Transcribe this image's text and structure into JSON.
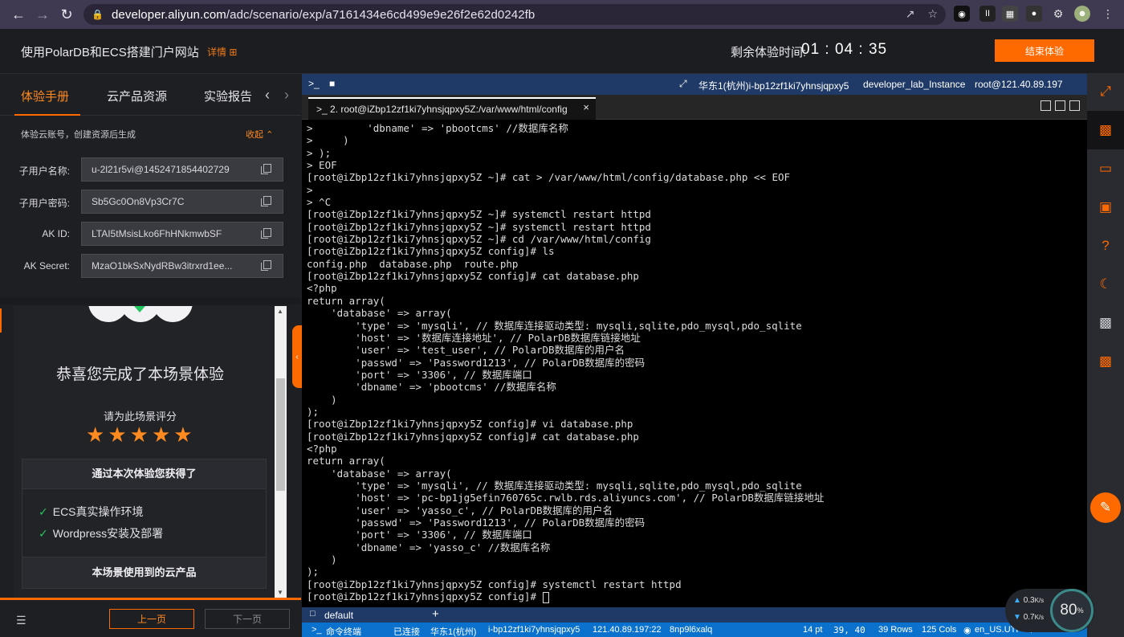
{
  "browser": {
    "url_prefix": "developer.aliyun.com",
    "url_path": "/adc/scenario/exp/a7161434e6cd499e9e26f2e62d0242fb"
  },
  "header": {
    "title": "使用PolarDB和ECS搭建门户网站",
    "detail_link": "详情",
    "timer_label": "剩余体验时间:",
    "timer_h": "01",
    "timer_m": "04",
    "timer_s": "35",
    "end_button": "结束体验"
  },
  "left_panel": {
    "tabs": [
      "体验手册",
      "云产品资源",
      "实验报告"
    ],
    "account_note": "体验云账号，创建资源后生成",
    "collapse_label": "收起",
    "fields": [
      {
        "label": "子用户名称:",
        "value": "u-2l21r5vi@1452471854402729"
      },
      {
        "label": "子用户密码:",
        "value": "Sb5Gc0On8Vp3Cr7C"
      },
      {
        "label": "AK ID:",
        "value": "LTAI5tMsisLko6FhHNkmwbSF"
      },
      {
        "label": "AK Secret:",
        "value": "MzaO1bkSxNydRBw3itrxrd1ee..."
      }
    ],
    "congrats": "恭喜您完成了本场景体验",
    "rate_prompt": "请为此场景评分",
    "rating_stars": 5,
    "gain_title": "通过本次体验您获得了",
    "gain_items": [
      "ECS真实操作环境",
      "Wordpress安装及部署"
    ],
    "products_title": "本场景使用到的云产品",
    "prev_button": "上一页",
    "next_button": "下一页"
  },
  "terminal": {
    "region_info": "华东1(杭州)i-bp12zf1ki7yhnsjqpxy5",
    "instance_name": "developer_lab_Instance",
    "login": "root@121.40.89.197",
    "tab_title": "2. root@iZbp12zf1ki7yhnsjqpxy5Z:/var/www/html/config",
    "lines": [
      ">         'dbname' => 'pbootcms' //数据库名称",
      ">     )",
      "> );",
      "> EOF",
      "[root@iZbp12zf1ki7yhnsjqpxy5Z ~]# cat > /var/www/html/config/database.php << EOF",
      ">",
      "> ^C",
      "[root@iZbp12zf1ki7yhnsjqpxy5Z ~]# systemctl restart httpd",
      "[root@iZbp12zf1ki7yhnsjqpxy5Z ~]# systemctl restart httpd",
      "[root@iZbp12zf1ki7yhnsjqpxy5Z ~]# cd /var/www/html/config",
      "[root@iZbp12zf1ki7yhnsjqpxy5Z config]# ls",
      "config.php  database.php  route.php",
      "[root@iZbp12zf1ki7yhnsjqpxy5Z config]# cat database.php",
      "<?php",
      "return array(",
      "    'database' => array(",
      "        'type' => 'mysqli', // 数据库连接驱动类型: mysqli,sqlite,pdo_mysql,pdo_sqlite",
      "        'host' => '数据库连接地址', // PolarDB数据库链接地址",
      "        'user' => 'test_user', // PolarDB数据库的用户名",
      "        'passwd' => 'Password1213', // PolarDB数据库的密码",
      "        'port' => '3306', // 数据库端口",
      "        'dbname' => 'pbootcms' //数据库名称",
      "    )",
      ");",
      "[root@iZbp12zf1ki7yhnsjqpxy5Z config]# vi database.php",
      "[root@iZbp12zf1ki7yhnsjqpxy5Z config]# cat database.php",
      "<?php",
      "return array(",
      "    'database' => array(",
      "        'type' => 'mysqli', // 数据库连接驱动类型: mysqli,sqlite,pdo_mysql,pdo_sqlite",
      "        'host' => 'pc-bp1jg5efin760765c.rwlb.rds.aliyuncs.com', // PolarDB数据库链接地址",
      "        'user' => 'yasso_c', // PolarDB数据库的用户名",
      "        'passwd' => 'Password1213', // PolarDB数据库的密码",
      "        'port' => '3306', // 数据库端口",
      "        'dbname' => 'yasso_c' //数据库名称",
      "    )",
      ");",
      "[root@iZbp12zf1ki7yhnsjqpxy5Z config]# systemctl restart httpd",
      "[root@iZbp12zf1ki7yhnsjqpxy5Z config]# "
    ],
    "session_tab": "default",
    "add_tab": "+",
    "status": {
      "mode": "命令终端",
      "connection": "已连接",
      "region": "华东1(杭州)",
      "instance": "i-bp12zf1ki7yhnsjqpxy5",
      "ip": "121.40.89.197:22",
      "session": "8np9l6xalq",
      "font": "14 pt",
      "cursor_pos": "39, 40",
      "rows": "39 Rows",
      "cols": "125 Cols",
      "locale": "en_US.UTF-8"
    }
  },
  "net_monitor": {
    "upload": "0.3",
    "download": "0.7",
    "unit": "K/s",
    "cpu_percent": "80",
    "percent_sign": "%"
  }
}
